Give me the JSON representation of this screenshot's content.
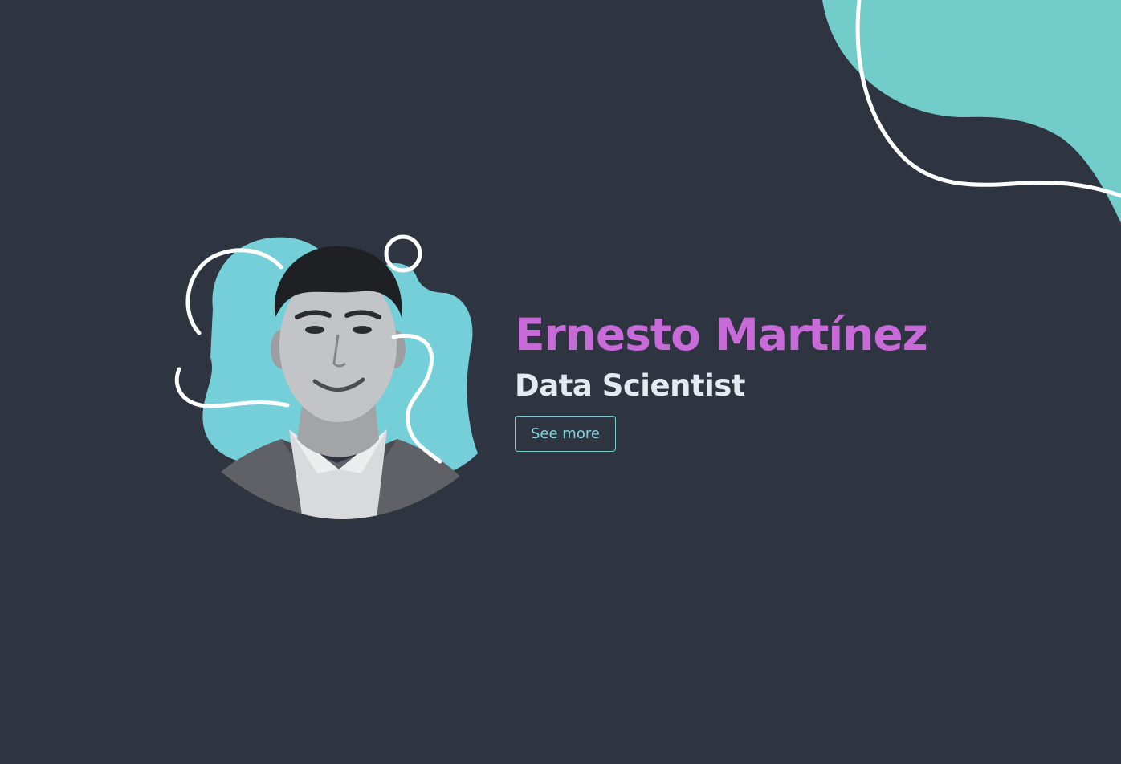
{
  "profile": {
    "name": "Ernesto Martínez",
    "title": "Data Scientist",
    "see_more_label": "See more"
  },
  "icons": {
    "avatar": "person-portrait-avatar",
    "blob_background": "teal-blob",
    "squiggle_decoration": "white-squiggle-lines",
    "corner_decoration": "teal-corner-blob"
  },
  "colors": {
    "background": "#2e3440",
    "accent_teal": "#74cfd9",
    "corner_teal": "#72cdca",
    "name": "#c96ad9",
    "title": "#e5e9f0",
    "button_border": "#72cdca",
    "button_text": "#7cd5df",
    "lines": "#ffffff"
  }
}
